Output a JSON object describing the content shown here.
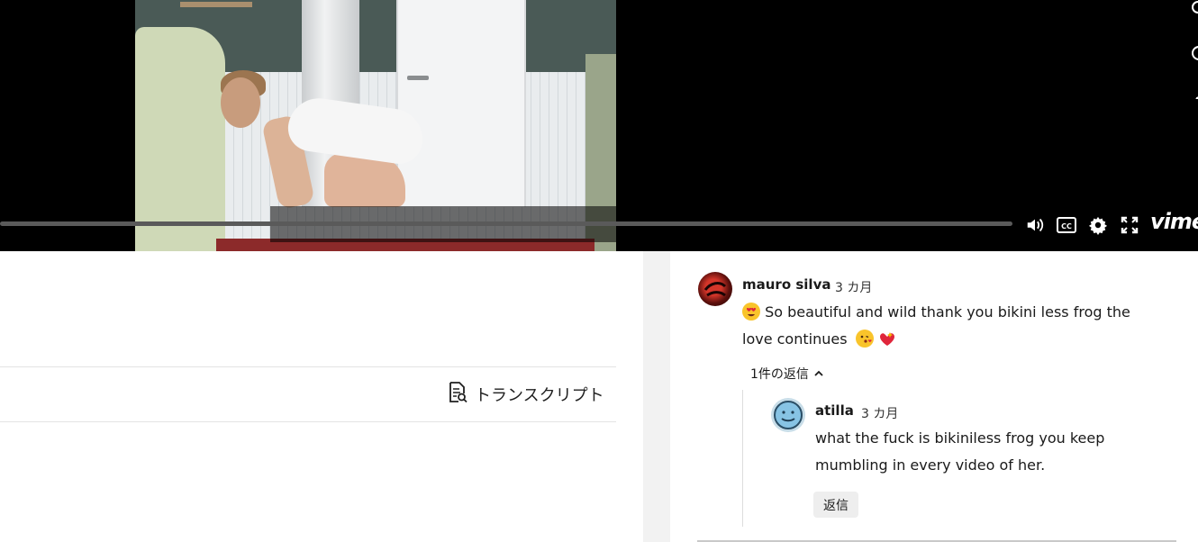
{
  "player": {
    "progress_fraction": 0.0,
    "brand_label": "vimeo",
    "icons": [
      "volume-icon",
      "captions-icon",
      "gear-icon",
      "fullscreen-icon"
    ],
    "colors": {
      "background": "#000000",
      "controls": "#ffffff",
      "track": "#5a5a5a"
    }
  },
  "transcript": {
    "label": "トランスクリプト"
  },
  "comments": [
    {
      "author": "mauro silva",
      "time": "3 カ月",
      "text_line1_emoji": "heart-eyes-emoji",
      "text_line1": "So beautiful and wild thank you bikini less frog the",
      "text_line2": "love continues",
      "text_line2_emojis": [
        "kiss-emoji",
        "heart-sparkle-emoji"
      ],
      "replies_toggle": "1件の返信",
      "replies": [
        {
          "author": "atilla",
          "time": "3 カ月",
          "text_line1": "what the fuck is bikiniless frog you keep",
          "text_line2": "mumbling in every video of her.",
          "reply_button": "返信"
        }
      ]
    }
  ]
}
